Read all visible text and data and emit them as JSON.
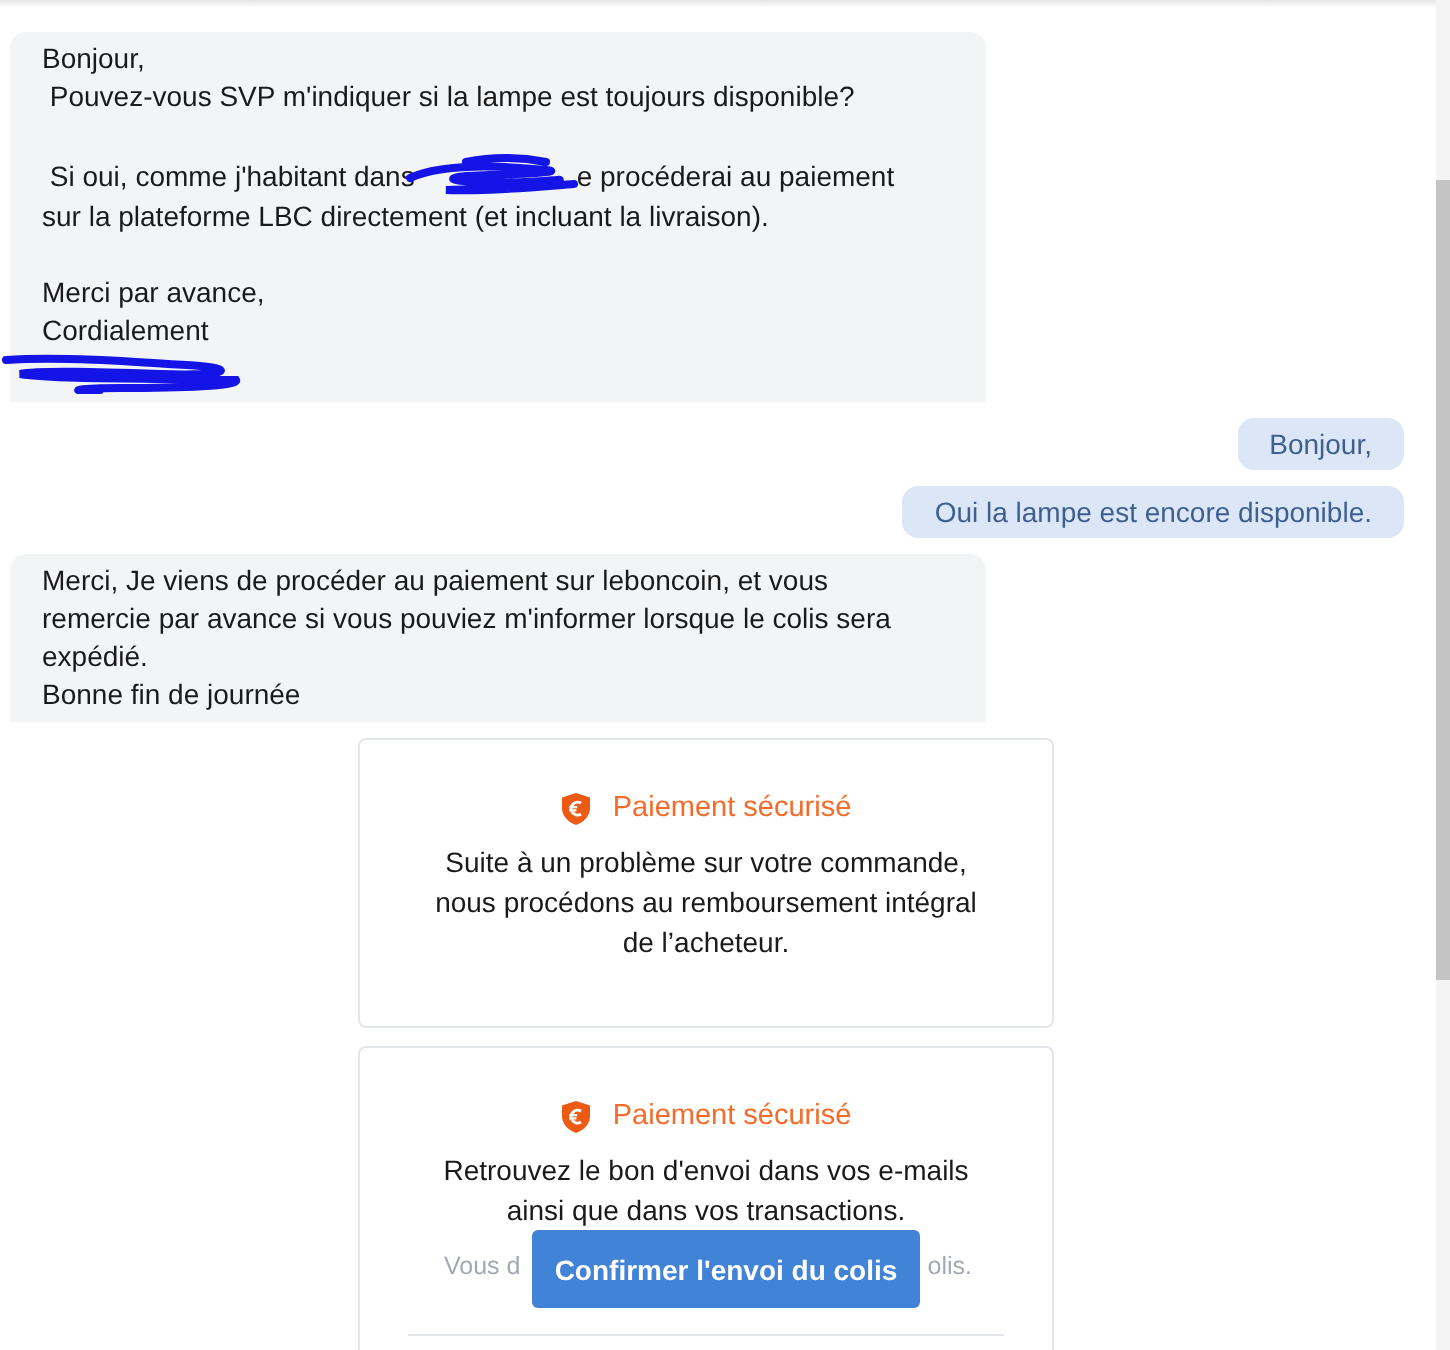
{
  "messages": [
    {
      "kind": "received",
      "lines": [
        {
          "kind": "text",
          "parts": [
            {
              "kind": "text",
              "text": "Bonjour,"
            }
          ]
        },
        {
          "kind": "text",
          "parts": [
            {
              "kind": "text",
              "text": " Pouvez-vous SVP m'indiquer si la lampe est toujours disponible?"
            }
          ]
        },
        {
          "kind": "spacer"
        },
        {
          "kind": "text",
          "parts": [
            {
              "kind": "text",
              "text": " Si oui, comme j'habitant dans"
            },
            {
              "kind": "scribble"
            },
            {
              "kind": "text",
              "text": "e procéderai au paiement"
            }
          ]
        },
        {
          "kind": "text",
          "parts": [
            {
              "kind": "text",
              "text": "sur la plateforme LBC directement (et incluant la livraison)."
            }
          ]
        },
        {
          "kind": "spacer"
        },
        {
          "kind": "text",
          "parts": [
            {
              "kind": "text",
              "text": "Merci par avance,"
            }
          ]
        },
        {
          "kind": "text",
          "parts": [
            {
              "kind": "text",
              "text": "Cordialement"
            }
          ]
        },
        {
          "kind": "text",
          "parts": [
            {
              "kind": "signature"
            }
          ]
        }
      ]
    },
    {
      "kind": "sent",
      "lines": [
        {
          "kind": "text",
          "parts": [
            {
              "kind": "text",
              "text": "Bonjour,"
            }
          ]
        }
      ]
    },
    {
      "kind": "sent",
      "lines": [
        {
          "kind": "text",
          "parts": [
            {
              "kind": "text",
              "text": "Oui la lampe est encore disponible."
            }
          ]
        }
      ]
    },
    {
      "kind": "received",
      "lines": [
        {
          "kind": "text",
          "parts": [
            {
              "kind": "text",
              "text": "Merci, Je viens de procéder au paiement sur leboncoin, et vous"
            }
          ]
        },
        {
          "kind": "text",
          "parts": [
            {
              "kind": "text",
              "text": "remercie par avance si vous pouviez m'informer lorsque le colis sera"
            }
          ]
        },
        {
          "kind": "text",
          "parts": [
            {
              "kind": "text",
              "text": "expédié."
            }
          ]
        },
        {
          "kind": "text",
          "parts": [
            {
              "kind": "text",
              "text": "Bonne fin de journée"
            }
          ]
        }
      ]
    }
  ],
  "cards": [
    {
      "title": "Paiement sécurisé",
      "body": [
        "Suite à un problème sur votre commande,",
        "nous procédons au remboursement intégral",
        "de l’acheteur."
      ]
    },
    {
      "title": "Paiement sécurisé",
      "body": [
        "Retrouvez le bon d'envoi dans vos e-mails",
        "ainsi que dans vos transactions."
      ],
      "hint_left": "Vous d",
      "hint_right": "olis.",
      "button": "Confirmer l'envoi du colis"
    }
  ]
}
